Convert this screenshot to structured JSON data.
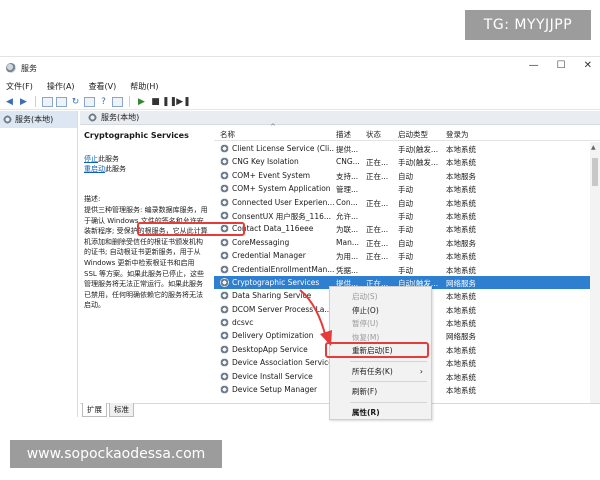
{
  "overlay": {
    "badge_top": "TG: MYYJJPP",
    "watermark": "www.sopockaodessa.com"
  },
  "window": {
    "title": "服务",
    "controls": [
      "—",
      "☐",
      "✕"
    ]
  },
  "menubar": {
    "items": [
      "文件(F)",
      "操作(A)",
      "查看(V)",
      "帮助(H)"
    ]
  },
  "toolbar": {
    "buttons": [
      "back-arrow",
      "forward-arrow",
      "console-tree",
      "properties",
      "refresh",
      "export",
      "help",
      "mmc",
      "start",
      "stop",
      "pause",
      "restart"
    ]
  },
  "navtree": {
    "root": "服务(本地)"
  },
  "content": {
    "header": "服务(本地)",
    "selected_service_title": "Cryptographic Services",
    "actions": {
      "stop_link": "停止",
      "stop_suffix": "此服务",
      "restart_link": "重启动",
      "restart_suffix": "此服务"
    },
    "description_label": "描述:",
    "description_text": "提供三种管理服务: 编录数据库服务，用于确认 Windows 文件的签名和允许安装新程序; 受保护的根服务，它从此计算机添加和删除受信任的根证书颁发机构的证书; 自动根证书更新服务，用于从 Windows 更新中检索根证书和启用 SSL 等方案。如果此服务已停止，这些管理服务将无法正常运行。如果此服务已禁用，任何明确依赖它的服务将无法启动。"
  },
  "list": {
    "columns": {
      "name": "名称",
      "desc": "描述",
      "status": "状态",
      "startup": "启动类型",
      "logon": "登录为"
    },
    "rows": [
      {
        "name": "Client License Service (Cli...",
        "desc": "提供...",
        "status": "",
        "startup": "手动(触发...",
        "logon": "本地系统"
      },
      {
        "name": "CNG Key Isolation",
        "desc": "CNG...",
        "status": "正在...",
        "startup": "手动(触发...",
        "logon": "本地系统"
      },
      {
        "name": "COM+ Event System",
        "desc": "支持...",
        "status": "正在...",
        "startup": "自动",
        "logon": "本地服务"
      },
      {
        "name": "COM+ System Application",
        "desc": "管理...",
        "status": "",
        "startup": "手动",
        "logon": "本地系统"
      },
      {
        "name": "Connected User Experien...",
        "desc": "Con...",
        "status": "正在...",
        "startup": "自动",
        "logon": "本地系统"
      },
      {
        "name": "ConsentUX 用户服务_116...",
        "desc": "允许...",
        "status": "",
        "startup": "手动",
        "logon": "本地系统"
      },
      {
        "name": "Contact Data_116eee",
        "desc": "为联...",
        "status": "正在...",
        "startup": "手动",
        "logon": "本地系统"
      },
      {
        "name": "CoreMessaging",
        "desc": "Man...",
        "status": "正在...",
        "startup": "自动",
        "logon": "本地服务"
      },
      {
        "name": "Credential Manager",
        "desc": "为用...",
        "status": "正在...",
        "startup": "手动",
        "logon": "本地系统"
      },
      {
        "name": "CredentialEnrollmentMan...",
        "desc": "凭据...",
        "status": "",
        "startup": "手动",
        "logon": "本地系统"
      },
      {
        "name": "Cryptographic Services",
        "desc": "提供...",
        "status": "正在...",
        "startup": "自动(触发...",
        "logon": "网络服务",
        "selected": true
      },
      {
        "name": "Data Sharing Service",
        "desc": "",
        "status": "",
        "startup": "",
        "logon": "本地系统"
      },
      {
        "name": "DCOM Server Process La...",
        "desc": "",
        "status": "",
        "startup": "",
        "logon": "本地系统"
      },
      {
        "name": "dcsvc",
        "desc": "",
        "status": "",
        "startup": "",
        "logon": "本地系统"
      },
      {
        "name": "Delivery Optimization",
        "desc": "",
        "status": "",
        "startup": "",
        "logon": "网络服务"
      },
      {
        "name": "DesktopApp Service",
        "desc": "",
        "status": "",
        "startup": "",
        "logon": "本地系统"
      },
      {
        "name": "Device Association Service",
        "desc": "",
        "status": "",
        "startup": "",
        "logon": "本地系统"
      },
      {
        "name": "Device Install Service",
        "desc": "",
        "status": "",
        "startup": "",
        "logon": "本地系统"
      },
      {
        "name": "Device Setup Manager",
        "desc": "",
        "status": "",
        "startup": "",
        "logon": "本地系统"
      }
    ]
  },
  "context_menu": {
    "start": "启动(S)",
    "stop": "停止(O)",
    "pause": "暂停(U)",
    "resume": "恢复(M)",
    "restart": "重新启动(E)",
    "all_tasks": "所有任务(K)",
    "refresh": "刷新(F)",
    "properties": "属性(R)"
  },
  "tabs": {
    "extended": "扩展",
    "standard": "标准"
  },
  "colors": {
    "selection": "#2e7fd0",
    "highlight_outline": "#e53b3b",
    "link": "#0b5fb8"
  }
}
